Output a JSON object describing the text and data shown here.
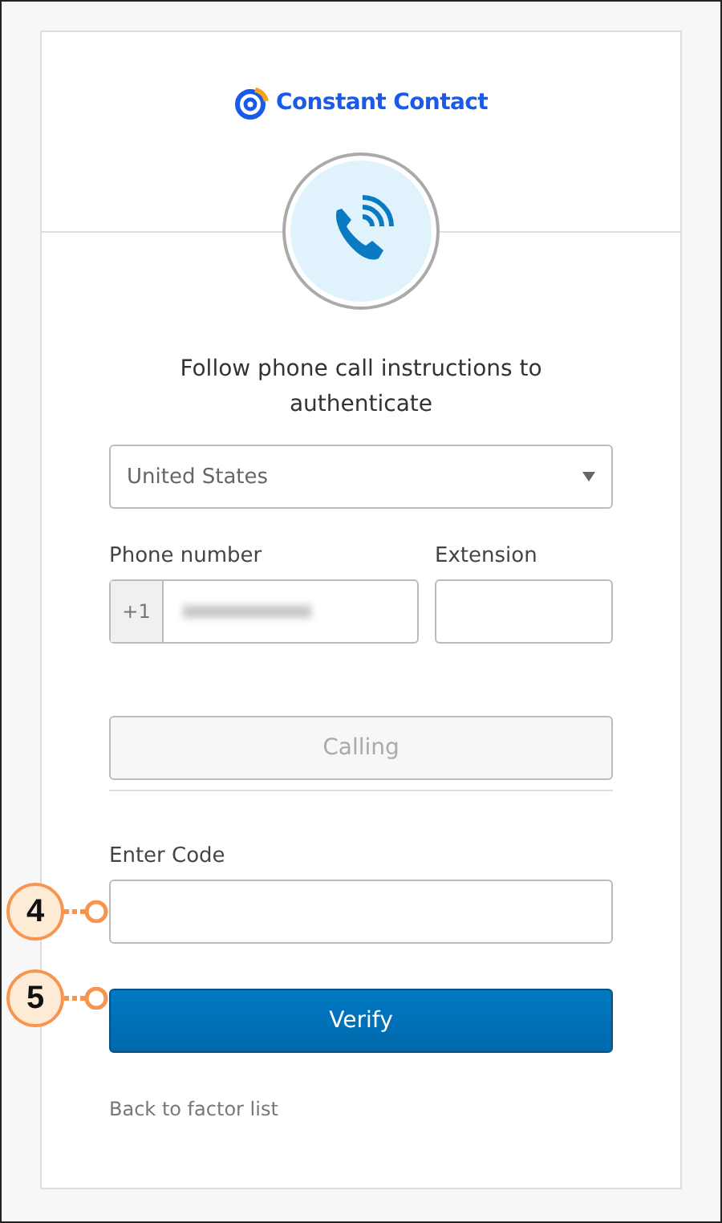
{
  "logo": {
    "text": "Constant Contact"
  },
  "heading": "Follow phone call instructions to authenticate",
  "country_select": {
    "value": "United States"
  },
  "phone": {
    "label": "Phone number",
    "prefix": "+1"
  },
  "extension": {
    "label": "Extension"
  },
  "call_button": {
    "label": "Calling",
    "disabled": true
  },
  "code": {
    "label": "Enter Code",
    "callout": "4"
  },
  "verify_button": {
    "label": "Verify",
    "disabled": false,
    "callout": "5"
  },
  "back_link": "Back to factor list"
}
